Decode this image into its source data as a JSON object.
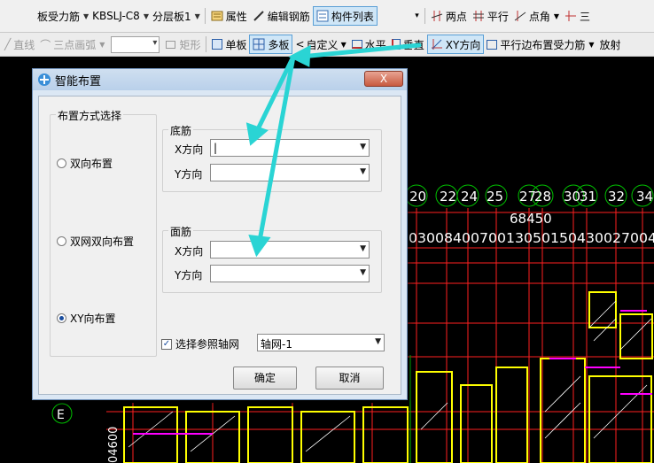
{
  "toolbar1": {
    "bottom_rebar": "板受力筋",
    "component_name": "KBSLJ-C8",
    "layer": "分层板1",
    "properties": "属性",
    "edit_rebar": "编辑钢筋",
    "component_list": "构件列表",
    "two_points": "两点",
    "parallel": "平行",
    "point_angle": "点角",
    "three_point": "三"
  },
  "toolbar2": {
    "line": "直线",
    "arc": "三点画弧",
    "rect": "矩形",
    "single_slab": "单板",
    "multi_slab": "多板",
    "custom": "自定义",
    "horizontal": "水平",
    "vertical": "垂直",
    "xy_direction": "XY方向",
    "parallel_edge": "平行边布置受力筋",
    "radial": "放射"
  },
  "canvas": {
    "axis_numbers": [
      "20",
      "22",
      "24",
      "25",
      "27",
      "28",
      "30",
      "31",
      "32",
      "34"
    ],
    "dimension_total": "68450",
    "dimension_row": "00300840070013050150430027004",
    "axis_E": "E",
    "left_dim": "04600"
  },
  "dialog": {
    "title": "智能布置",
    "close_label": "X",
    "layout_group_label": "布置方式选择",
    "options": [
      "双向布置",
      "双网双向布置",
      "XY向布置"
    ],
    "selected_option": "XY向布置",
    "bottom_group_label": "底筋",
    "top_group_label": "面筋",
    "x_label": "X方向",
    "y_label": "Y方向",
    "bottom_x_value": "|",
    "bottom_y_value": "",
    "top_x_value": "",
    "top_y_value": "",
    "ref_axis_label": "选择参照轴网",
    "ref_axis_checked": true,
    "ref_axis_value": "轴网-1",
    "ok_label": "确定",
    "cancel_label": "取消"
  },
  "colors": {
    "annotation_arrow": "#2ad4d4",
    "grid_red": "#ff2020",
    "rebar_yellow": "#ffff00",
    "rebar_magenta": "#ff00ff",
    "axis_green": "#00c000"
  }
}
